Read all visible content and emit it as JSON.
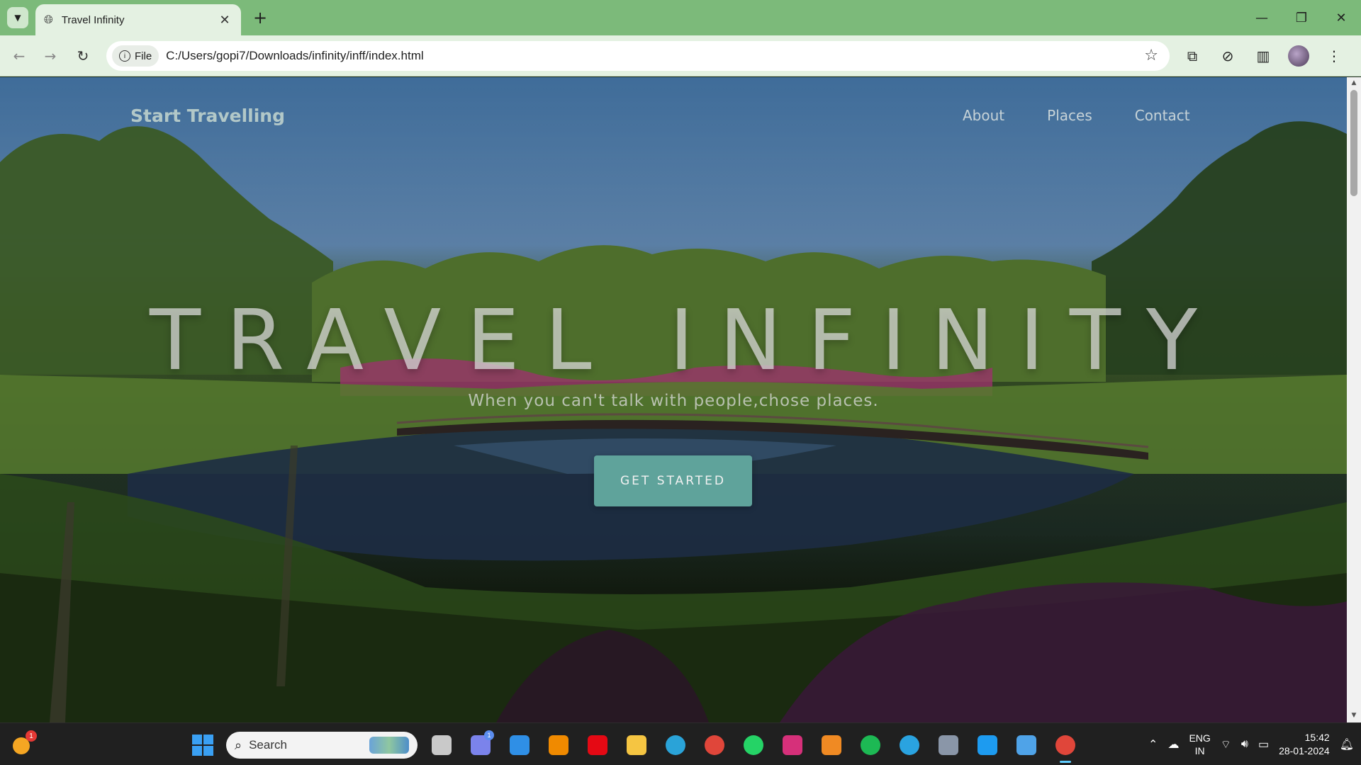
{
  "browser": {
    "tab_title": "Travel Infinity",
    "site_chip": "File",
    "url": "C:/Users/gopi7/Downloads/infinity/inff/index.html"
  },
  "site": {
    "brand": "Start Travelling",
    "nav": [
      "About",
      "Places",
      "Contact"
    ],
    "hero_title": "TRAVEL INFINITY",
    "hero_subtitle": "When you can't talk with people,chose places.",
    "cta_label": "GET STARTED"
  },
  "taskbar": {
    "weather_badge": "1",
    "search_placeholder": "Search",
    "teams_badge": "1",
    "apps": [
      {
        "name": "task-view-icon",
        "color": "#c9c9c9"
      },
      {
        "name": "teams-icon",
        "color": "#7b83eb"
      },
      {
        "name": "vscode-icon",
        "color": "#2f8fe6"
      },
      {
        "name": "vlc-icon",
        "color": "#f08a00"
      },
      {
        "name": "netflix-icon",
        "color": "#e50914"
      },
      {
        "name": "file-explorer-icon",
        "color": "#f5c542"
      },
      {
        "name": "edge-icon",
        "color": "#2aa3d8"
      },
      {
        "name": "chrome-icon",
        "color": "#e0463a"
      },
      {
        "name": "whatsapp-icon",
        "color": "#25d366"
      },
      {
        "name": "instagram-icon",
        "color": "#d6307a"
      },
      {
        "name": "blender-icon",
        "color": "#f08a23"
      },
      {
        "name": "spotify-icon",
        "color": "#1db954"
      },
      {
        "name": "telegram-icon",
        "color": "#2aa3e0"
      },
      {
        "name": "settings-icon",
        "color": "#8a96a8"
      },
      {
        "name": "twitter-icon",
        "color": "#1d9bf0"
      },
      {
        "name": "notepad-icon",
        "color": "#4fa3e8"
      },
      {
        "name": "chrome-active-icon",
        "color": "#e0463a"
      }
    ],
    "lang_line1": "ENG",
    "lang_line2": "IN",
    "time": "15:42",
    "date": "28-01-2024"
  }
}
